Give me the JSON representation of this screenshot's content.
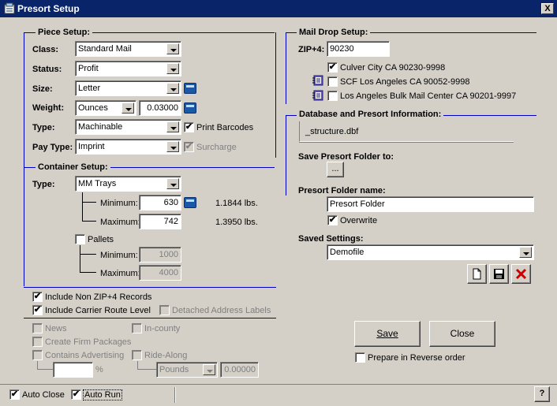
{
  "window": {
    "title": "Presort Setup",
    "close_glyph": "X"
  },
  "piece_setup": {
    "heading": "Piece Setup:",
    "class_label": "Class:",
    "class_value": "Standard Mail",
    "status_label": "Status:",
    "status_value": "Profit",
    "size_label": "Size:",
    "size_value": "Letter",
    "weight_label": "Weight:",
    "weight_unit": "Ounces",
    "weight_value": "0.03000",
    "type_label": "Type:",
    "type_value": "Machinable",
    "print_barcodes": "Print Barcodes",
    "print_barcodes_checked": true,
    "paytype_label": "Pay Type:",
    "paytype_value": "Imprint",
    "surcharge": "Surcharge",
    "surcharge_checked": true
  },
  "container_setup": {
    "heading": "Container Setup:",
    "type_label": "Type:",
    "type_value": "MM Trays",
    "min_label": "Minimum:",
    "min_value": "630",
    "min_lbs": "1.1844 lbs.",
    "max_label": "Maximum:",
    "max_value": "742",
    "max_lbs": "1.3950 lbs.",
    "pallets": "Pallets",
    "pallets_checked": false,
    "pallet_min_label": "Minimum:",
    "pallet_min_value": "1000",
    "pallet_max_label": "Maximum:",
    "pallet_max_value": "4000"
  },
  "options": {
    "include_non_zip4": "Include Non ZIP+4 Records",
    "include_non_zip4_checked": true,
    "include_carrier_route": "Include Carrier Route Level",
    "include_carrier_route_checked": true,
    "detached_labels": "Detached Address Labels",
    "news": "News",
    "in_county": "In-county",
    "create_firm": "Create Firm Packages",
    "contains_advertising": "Contains Advertising",
    "ride_along": "Ride-Along",
    "percent_symbol": "%",
    "ride_along_unit": "Pounds",
    "ride_along_value": "0.00000"
  },
  "mail_drop": {
    "heading": "Mail Drop Setup:",
    "zip_label": "ZIP+4:",
    "zip_value": "90230",
    "drops": [
      {
        "label": "Culver City CA 90230-9998",
        "checked": true
      },
      {
        "label": "SCF Los Angeles CA 90052-9998",
        "checked": false
      },
      {
        "label": "Los Angeles Bulk Mail Center CA 90201-9997",
        "checked": false
      }
    ]
  },
  "database": {
    "heading": "Database and Presort Information:",
    "file": "_structure.dbf",
    "save_folder_label": "Save Presort Folder to:",
    "browse_label": "...",
    "folder_name_label": "Presort Folder name:",
    "folder_name_value": "Presort Folder",
    "overwrite": "Overwrite",
    "overwrite_checked": true,
    "saved_settings_label": "Saved Settings:",
    "saved_settings_value": "Demofile"
  },
  "actions": {
    "save": "Save",
    "close": "Close",
    "reverse_order": "Prepare in Reverse order",
    "reverse_checked": false
  },
  "statusbar": {
    "auto_close": "Auto Close",
    "auto_close_checked": true,
    "auto_run": "Auto Run",
    "auto_run_checked": true,
    "help": "?"
  },
  "colors": {
    "title_bar": "#0a246a",
    "group_line": "#0000c0",
    "face": "#d4d0c8",
    "delete_red": "#cc0000"
  }
}
